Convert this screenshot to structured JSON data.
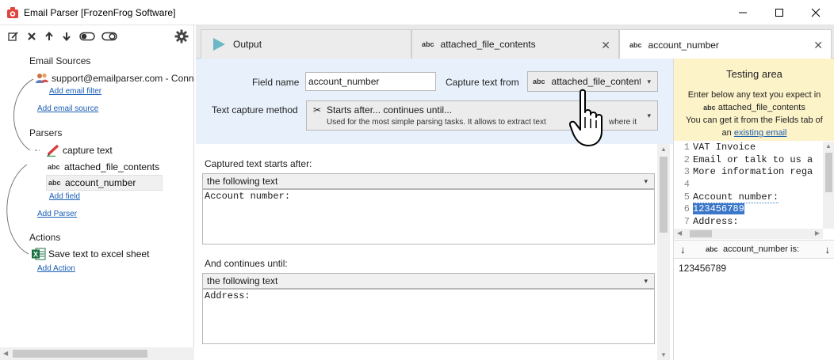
{
  "window": {
    "title": "Email Parser [FrozenFrog Software]"
  },
  "left": {
    "email_sources_heading": "Email Sources",
    "email_source": "support@emailparser.com - Conn",
    "add_email_filter": "Add email filter",
    "add_email_source": "Add email source",
    "parsers_heading": "Parsers",
    "parser_name": "capture text",
    "fields": [
      {
        "label": "attached_file_contents"
      },
      {
        "label": "account_number"
      }
    ],
    "add_field": "Add field",
    "add_parser": "Add Parser",
    "actions_heading": "Actions",
    "action_name": "Save text to excel sheet",
    "add_action": "Add Action"
  },
  "tabs": [
    {
      "label": "Output"
    },
    {
      "label": "attached_file_contents"
    },
    {
      "label": "account_number"
    }
  ],
  "config": {
    "field_name_label": "Field name",
    "field_name_value": "account_number",
    "capture_from_label": "Capture text from",
    "capture_from_value": "attached_file_contents",
    "method_label": "Text capture method",
    "method_title": "Starts after... continues until...",
    "method_desc": "Used for the most simple parsing tasks. It allows to extract text",
    "method_desc_tail": "where it"
  },
  "capture": {
    "starts_after_label": "Captured text starts after:",
    "starts_after_mode": "the following text",
    "starts_after_text": "Account number:",
    "continues_label": "And continues until:",
    "continues_mode": "the following text",
    "continues_text": "Address:"
  },
  "testing": {
    "title": "Testing area",
    "desc_line1": "Enter below any text you expect in",
    "desc_field": "attached_file_contents",
    "desc_line2": "You can get it from the Fields tab of",
    "desc_an": "an",
    "desc_link": "existing email",
    "lines": [
      {
        "n": "1",
        "text": "VAT Invoice"
      },
      {
        "n": "2",
        "text": "Email or talk to us a"
      },
      {
        "n": "3",
        "text": "More information rega"
      },
      {
        "n": "4",
        "text": ""
      },
      {
        "n": "5",
        "text": "Account number:"
      },
      {
        "n": "6",
        "text": "123456789"
      },
      {
        "n": "7",
        "text": "Address:"
      }
    ],
    "result_label": "account_number is:",
    "result_value": "123456789"
  },
  "colors": {
    "accent_blue": "#1a5fb4",
    "config_bg": "#e8f1fb",
    "testing_bg": "#fdf3c9",
    "highlight": "#3b77c9"
  }
}
